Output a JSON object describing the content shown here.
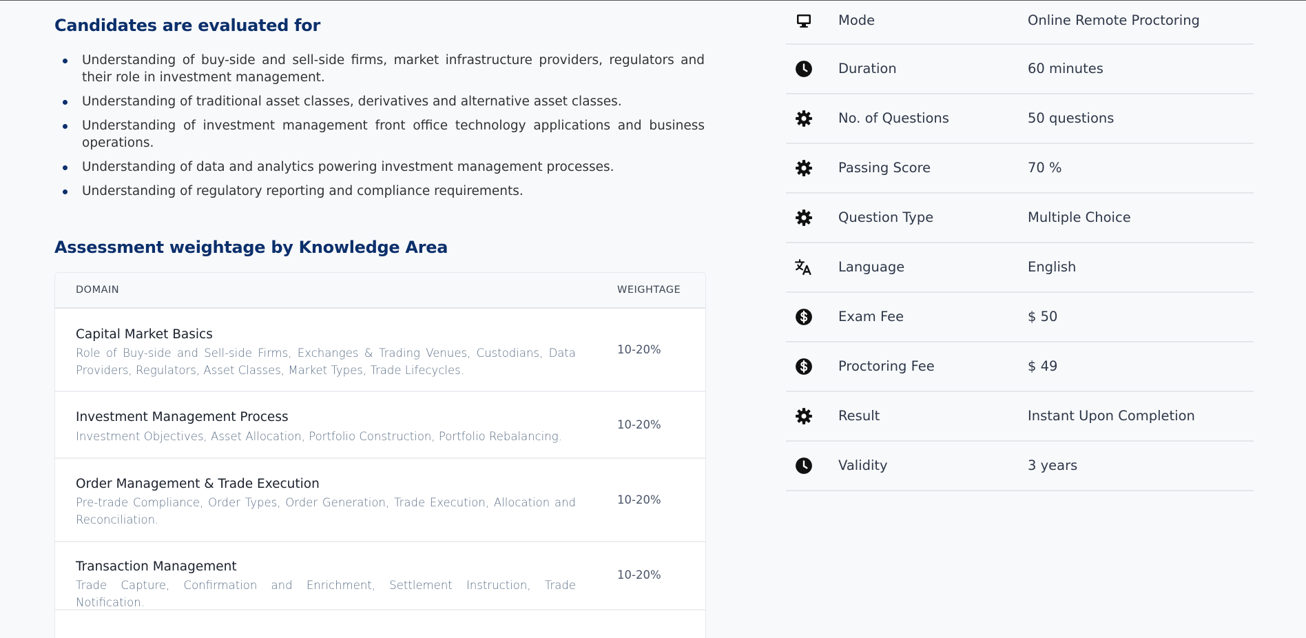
{
  "evaluated": {
    "title": "Candidates are evaluated for",
    "items": [
      "Understanding of buy-side and sell-side firms, market infrastructure providers, regulators and their role in investment management.",
      "Understanding of traditional asset classes, derivatives and alternative asset classes.",
      "Understanding of investment management front office technology applications and business operations.",
      "Understanding of data and analytics powering investment management processes.",
      "Understanding of regulatory reporting and compliance requirements."
    ]
  },
  "weightage": {
    "title": "Assessment weightage by Knowledge Area",
    "headers": {
      "domain": "DOMAIN",
      "weightage": "WEIGHTAGE"
    },
    "rows": [
      {
        "name": "Capital Market Basics",
        "desc": "Role of Buy-side and Sell-side Firms, Exchanges & Trading Venues, Custodians, Data Providers, Regulators, Asset Classes, Market Types, Trade Lifecycles.",
        "weight": "10-20%"
      },
      {
        "name": "Investment Management Process",
        "desc": "Investment Objectives, Asset Allocation, Portfolio Construction, Portfolio Rebalancing.",
        "weight": "10-20%"
      },
      {
        "name": "Order Management & Trade Execution",
        "desc": "Pre-trade Compliance, Order Types, Order Generation, Trade Execution, Allocation and Reconciliation.",
        "weight": "10-20%"
      },
      {
        "name": "Transaction Management",
        "desc": "Trade Capture, Confirmation and Enrichment, Settlement Instruction, Trade Notification.",
        "weight": "10-20%"
      }
    ]
  },
  "exam_info": [
    {
      "icon": "monitor-icon",
      "label": "Mode",
      "value": "Online Remote Proctoring"
    },
    {
      "icon": "clock-icon",
      "label": "Duration",
      "value": "60 minutes"
    },
    {
      "icon": "gear-icon",
      "label": "No. of Questions",
      "value": "50 questions"
    },
    {
      "icon": "gear-icon",
      "label": "Passing Score",
      "value": "70 %"
    },
    {
      "icon": "gear-icon",
      "label": "Question Type",
      "value": "Multiple Choice"
    },
    {
      "icon": "translate-icon",
      "label": "Language",
      "value": "English"
    },
    {
      "icon": "dollar-icon",
      "label": "Exam Fee",
      "value": "$ 50"
    },
    {
      "icon": "dollar-icon",
      "label": "Proctoring Fee",
      "value": "$ 49"
    },
    {
      "icon": "gear-icon",
      "label": "Result",
      "value": "Instant Upon Completion"
    },
    {
      "icon": "clock-icon",
      "label": "Validity",
      "value": "3 years"
    }
  ],
  "colors": {
    "heading": "#0b2f6b",
    "desc": "#5b6f87",
    "icon": "#111111"
  }
}
